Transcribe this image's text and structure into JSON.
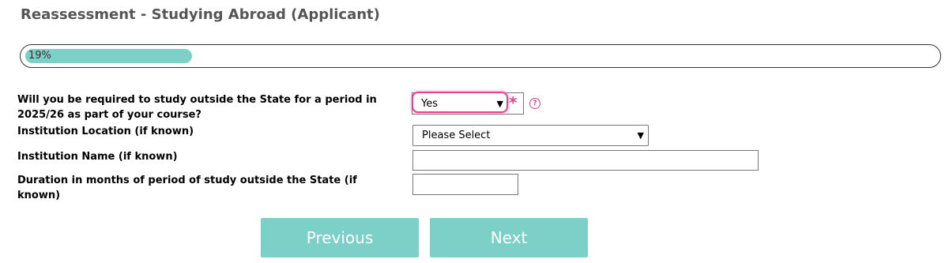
{
  "header": {
    "title": "Reassessment - Studying Abroad (Applicant)"
  },
  "progress": {
    "percent": 19,
    "label": "19%",
    "fill_color": "#7dd0c8"
  },
  "form": {
    "q_study_outside": {
      "label": "Will you be required to study outside the State for a period in 2025/26 as part of your course?",
      "value": "Yes",
      "required_mark": "*",
      "help_icon": "question-circle-icon"
    },
    "q_institution_location": {
      "label": "Institution Location (if known)",
      "value": "Please Select"
    },
    "q_institution_name": {
      "label": "Institution Name (if known)",
      "value": ""
    },
    "q_duration": {
      "label": "Duration in months of period of study outside the State (if known)",
      "value": ""
    }
  },
  "buttons": {
    "previous": "Previous",
    "next": "Next"
  },
  "colors": {
    "accent": "#7dd0c8",
    "required": "#e8418f"
  }
}
